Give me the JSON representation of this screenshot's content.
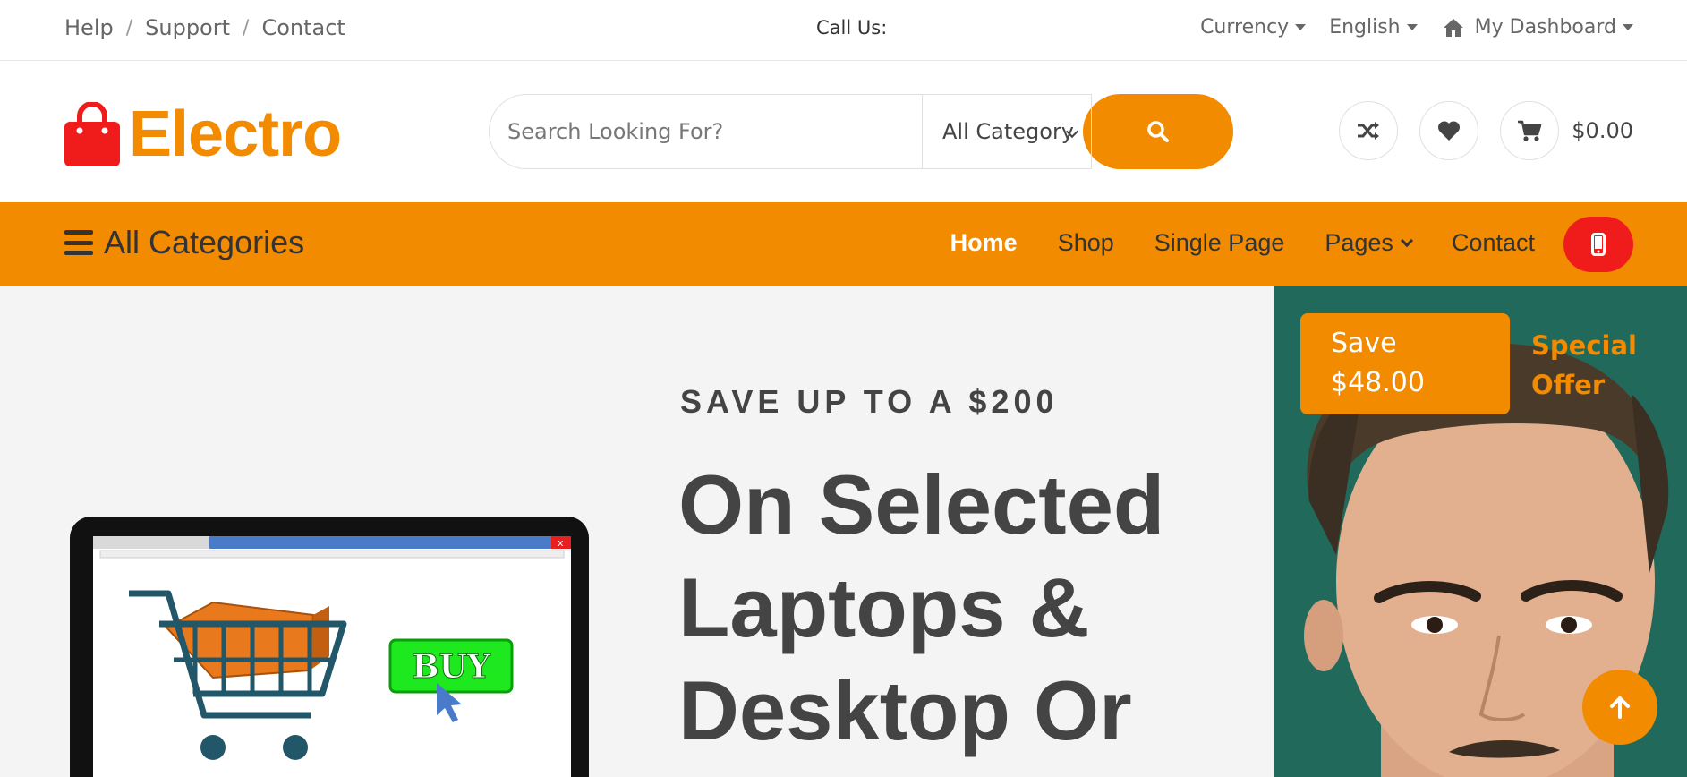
{
  "topbar": {
    "links": [
      "Help",
      "Support",
      "Contact"
    ],
    "call_us": "Call Us:",
    "currency": "Currency",
    "language": "English",
    "dashboard": "My Dashboard"
  },
  "header": {
    "logo_text": "Electro",
    "search_placeholder": "Search Looking For?",
    "category_selected": "All Category",
    "cart_total": "$0.00"
  },
  "nav": {
    "all_categories": "All Categories",
    "items": [
      "Home",
      "Shop",
      "Single Page",
      "Pages",
      "Contact"
    ],
    "active": "Home"
  },
  "hero": {
    "eyebrow": "SAVE UP TO A $200",
    "headline_lines": [
      "On Selected",
      "Laptops &",
      "Desktop Or"
    ],
    "buy_label": "BUY"
  },
  "offer": {
    "save_label": "Save",
    "save_amount": "$48.00",
    "special_line1": "Special",
    "special_line2": "Offer"
  },
  "colors": {
    "accent": "#f28b00",
    "danger": "#f01c1c",
    "offer_bg": "#21695a",
    "hero_bg": "#f4f4f4"
  },
  "icons": [
    "home-icon",
    "bag-icon",
    "search-icon",
    "shuffle-icon",
    "heart-icon",
    "cart-icon",
    "menu-icon",
    "phone-icon",
    "arrow-up-icon"
  ]
}
